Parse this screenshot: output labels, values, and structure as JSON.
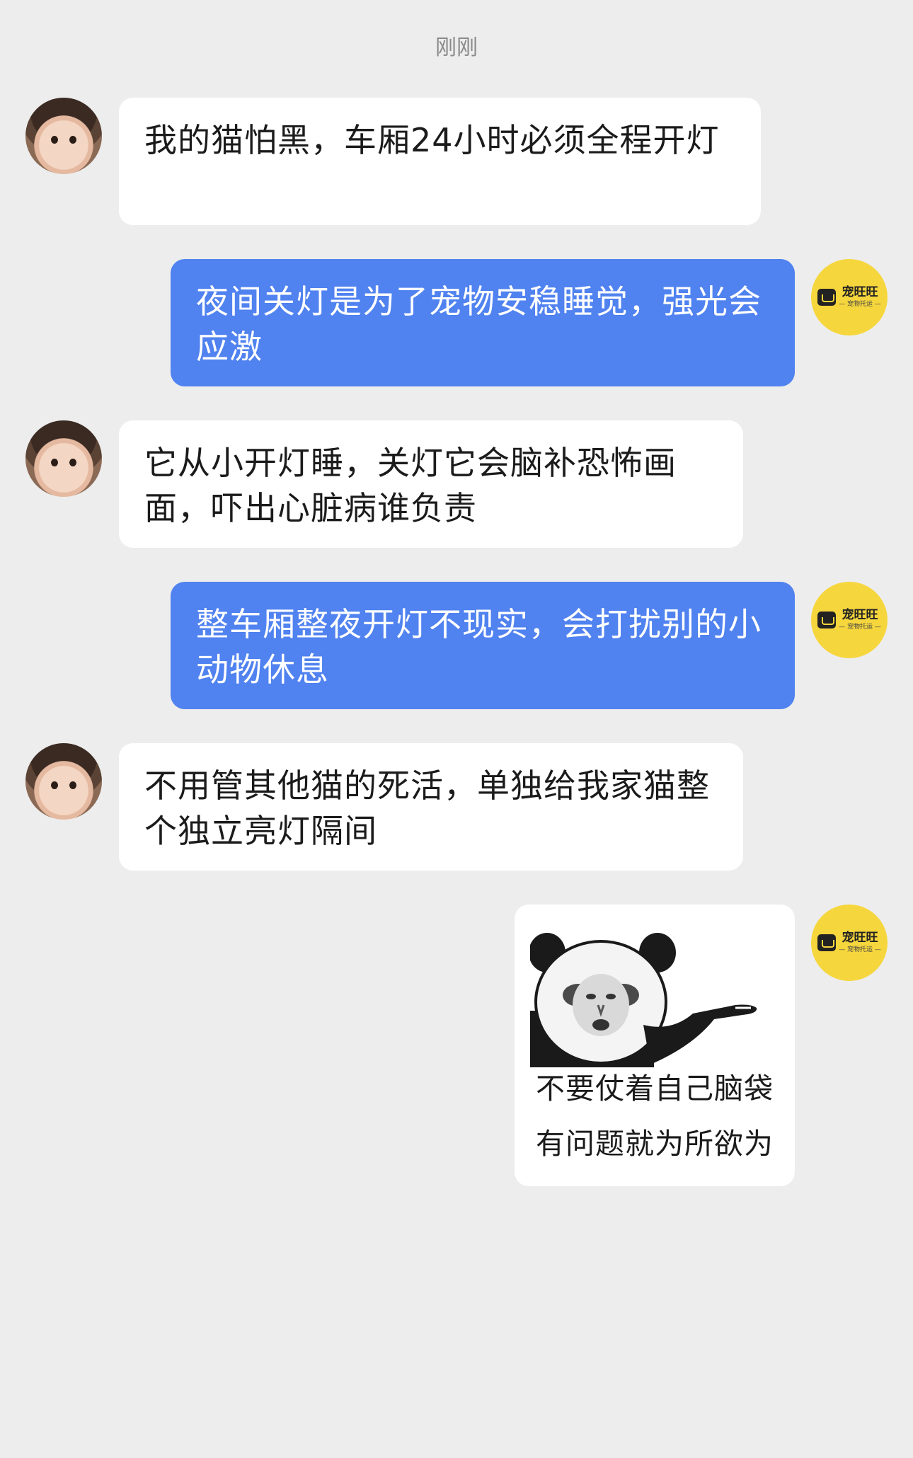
{
  "chat": {
    "timestamp": "刚刚",
    "messages": [
      {
        "sender": "customer",
        "text": "我的猫怕黑，车厢24小时必须全程开灯"
      },
      {
        "sender": "service",
        "text": "夜间关灯是为了宠物安稳睡觉，强光会应激"
      },
      {
        "sender": "customer",
        "text": "它从小开灯睡，关灯它会脑补恐怖画面，吓出心脏病谁负责"
      },
      {
        "sender": "service",
        "text": "整车厢整夜开灯不现实，会打扰别的小动物休息"
      },
      {
        "sender": "customer",
        "text": "不用管其他猫的死活，单独给我家猫整个独立亮灯隔间"
      }
    ],
    "sticker": {
      "line1": "不要仗着自己脑袋",
      "line2": "有问题就为所欲为"
    }
  },
  "brand": {
    "name": "宠旺旺",
    "tagline": "— 宠物托运 —",
    "color": "#f6d63d"
  },
  "colors": {
    "background": "#ededed",
    "outgoing_bubble": "#5082f0",
    "incoming_bubble": "#ffffff"
  }
}
